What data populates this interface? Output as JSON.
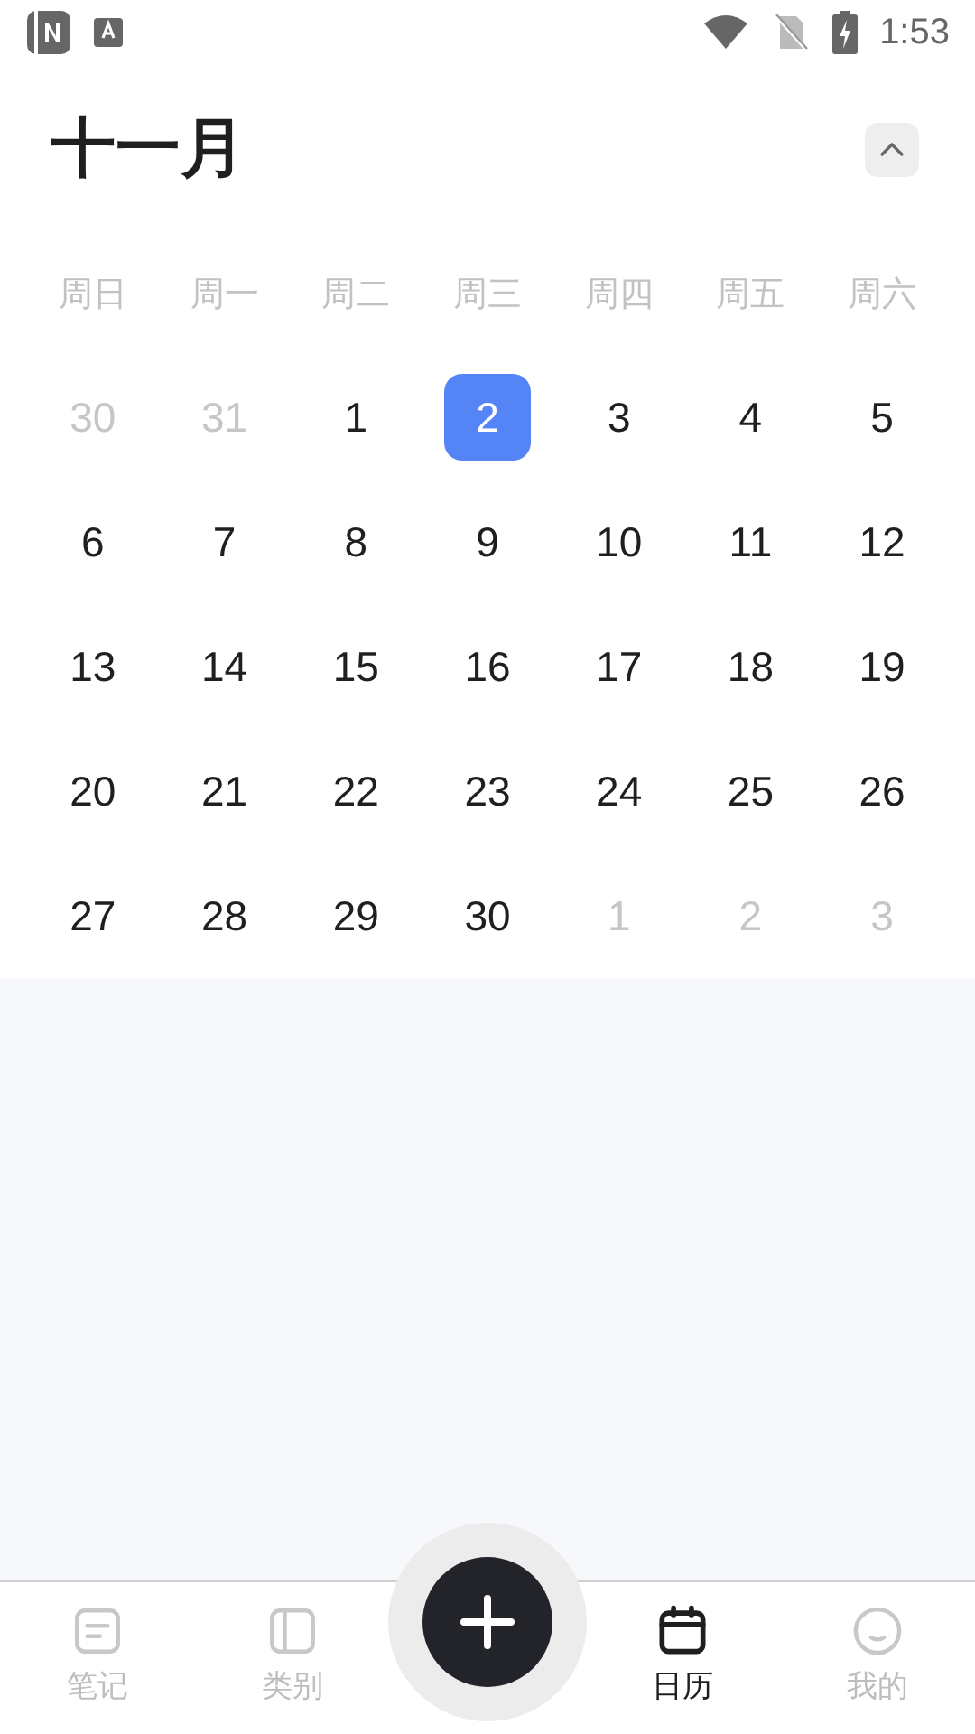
{
  "status_bar": {
    "time": "1:53"
  },
  "header": {
    "title": "十一月",
    "collapse_expanded": true
  },
  "weekdays": [
    "周日",
    "周一",
    "周二",
    "周三",
    "周四",
    "周五",
    "周六"
  ],
  "days": [
    {
      "text": "30",
      "in_month": false,
      "selected": false
    },
    {
      "text": "31",
      "in_month": false,
      "selected": false
    },
    {
      "text": "1",
      "in_month": true,
      "selected": false
    },
    {
      "text": "2",
      "in_month": true,
      "selected": true
    },
    {
      "text": "3",
      "in_month": true,
      "selected": false
    },
    {
      "text": "4",
      "in_month": true,
      "selected": false
    },
    {
      "text": "5",
      "in_month": true,
      "selected": false
    },
    {
      "text": "6",
      "in_month": true,
      "selected": false
    },
    {
      "text": "7",
      "in_month": true,
      "selected": false
    },
    {
      "text": "8",
      "in_month": true,
      "selected": false
    },
    {
      "text": "9",
      "in_month": true,
      "selected": false
    },
    {
      "text": "10",
      "in_month": true,
      "selected": false
    },
    {
      "text": "11",
      "in_month": true,
      "selected": false
    },
    {
      "text": "12",
      "in_month": true,
      "selected": false
    },
    {
      "text": "13",
      "in_month": true,
      "selected": false
    },
    {
      "text": "14",
      "in_month": true,
      "selected": false
    },
    {
      "text": "15",
      "in_month": true,
      "selected": false
    },
    {
      "text": "16",
      "in_month": true,
      "selected": false
    },
    {
      "text": "17",
      "in_month": true,
      "selected": false
    },
    {
      "text": "18",
      "in_month": true,
      "selected": false
    },
    {
      "text": "19",
      "in_month": true,
      "selected": false
    },
    {
      "text": "20",
      "in_month": true,
      "selected": false
    },
    {
      "text": "21",
      "in_month": true,
      "selected": false
    },
    {
      "text": "22",
      "in_month": true,
      "selected": false
    },
    {
      "text": "23",
      "in_month": true,
      "selected": false
    },
    {
      "text": "24",
      "in_month": true,
      "selected": false
    },
    {
      "text": "25",
      "in_month": true,
      "selected": false
    },
    {
      "text": "26",
      "in_month": true,
      "selected": false
    },
    {
      "text": "27",
      "in_month": true,
      "selected": false
    },
    {
      "text": "28",
      "in_month": true,
      "selected": false
    },
    {
      "text": "29",
      "in_month": true,
      "selected": false
    },
    {
      "text": "30",
      "in_month": true,
      "selected": false
    },
    {
      "text": "1",
      "in_month": false,
      "selected": false
    },
    {
      "text": "2",
      "in_month": false,
      "selected": false
    },
    {
      "text": "3",
      "in_month": false,
      "selected": false
    }
  ],
  "nav": [
    {
      "kind": "notes",
      "label": "笔记",
      "selected": false
    },
    {
      "kind": "category",
      "label": "类别",
      "selected": false
    },
    {
      "kind": "add"
    },
    {
      "kind": "calendar",
      "label": "日历",
      "selected": true
    },
    {
      "kind": "profile",
      "label": "我的",
      "selected": false
    }
  ]
}
